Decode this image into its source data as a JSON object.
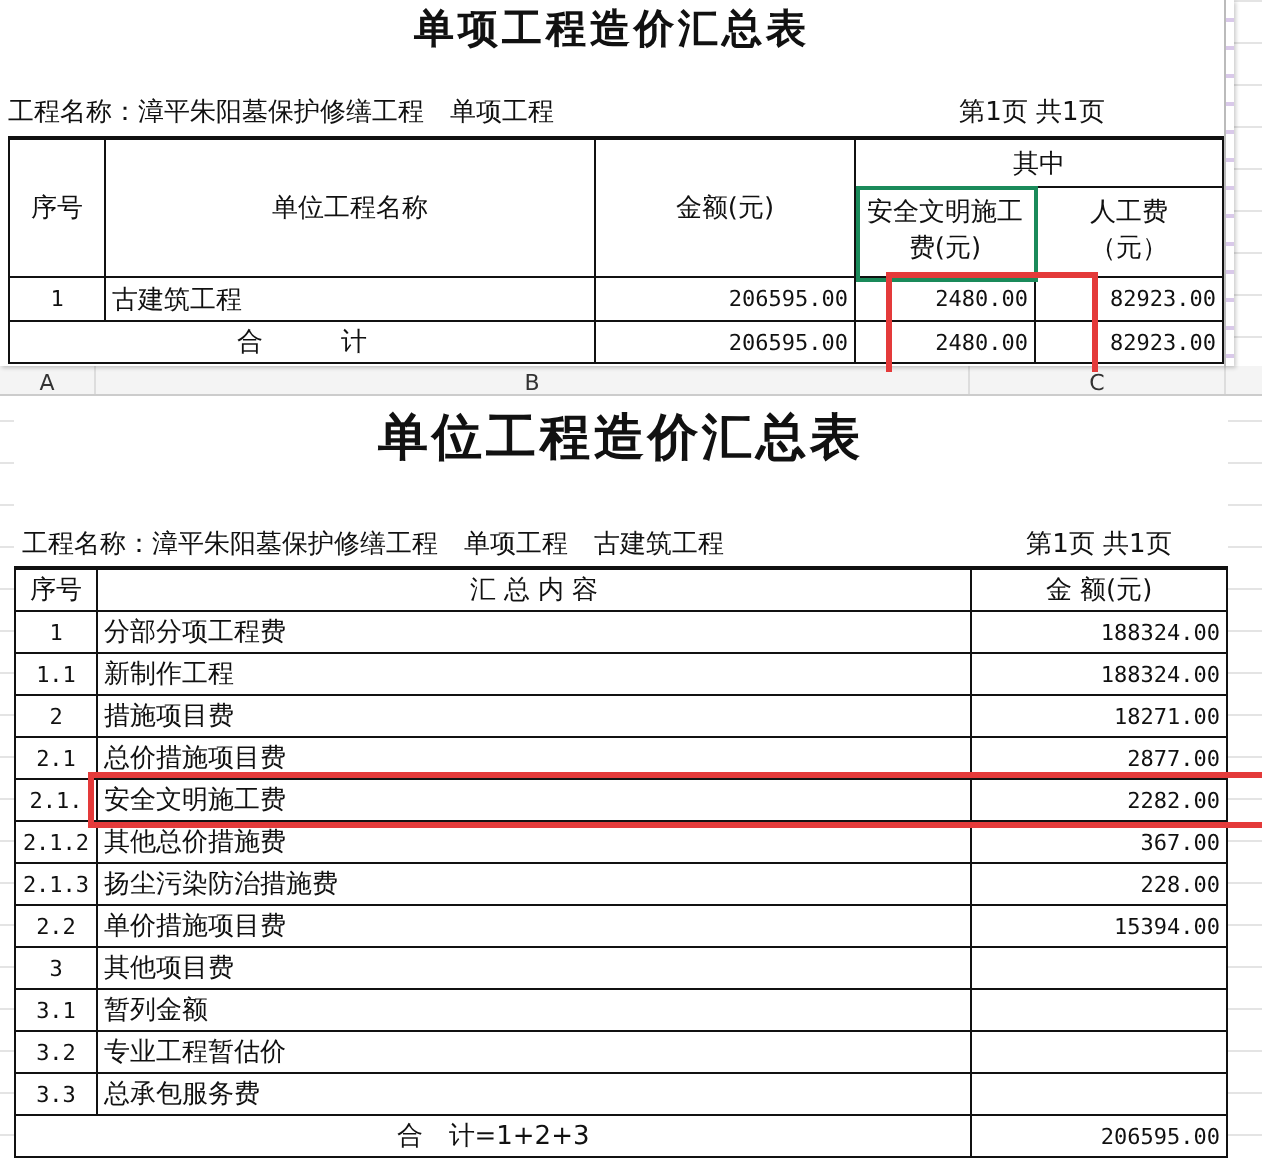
{
  "top_sheet": {
    "title": "单项工程造价汇总表",
    "project": "工程名称：漳平朱阳墓保护修缮工程　单项工程",
    "page": "第1页 共1页",
    "headers": {
      "no": "序号",
      "name": "单位工程名称",
      "amount": "金额(元)",
      "group": "其中",
      "safety": "安全文明施工费(元)",
      "labor": "人工费（元）"
    },
    "rows": [
      {
        "no": "1",
        "name": "古建筑工程",
        "amount": "206595.00",
        "safety": "2480.00",
        "labor": "82923.00"
      }
    ],
    "total": {
      "label": "合　　　计",
      "amount": "206595.00",
      "safety": "2480.00",
      "labor": "82923.00"
    }
  },
  "column_headers": [
    "A",
    "B",
    "C"
  ],
  "bottom_sheet": {
    "title": "单位工程造价汇总表",
    "project": "工程名称：漳平朱阳墓保护修缮工程　单项工程　古建筑工程",
    "page": "第1页 共1页",
    "headers": {
      "no": "序号",
      "content": "汇 总 内 容",
      "amount": "金 额(元)"
    },
    "rows": [
      {
        "no": "1",
        "name": "分部分项工程费",
        "amount": "188324.00"
      },
      {
        "no": "1.1",
        "name": "新制作工程",
        "amount": "188324.00"
      },
      {
        "no": "2",
        "name": "措施项目费",
        "amount": "18271.00"
      },
      {
        "no": "2.1",
        "name": "总价措施项目费",
        "amount": "2877.00"
      },
      {
        "no": "2.1.",
        "name": "安全文明施工费",
        "amount": "2282.00"
      },
      {
        "no": "2.1.2",
        "name": "其他总价措施费",
        "amount": "367.00"
      },
      {
        "no": "2.1.3",
        "name": "扬尘污染防治措施费",
        "amount": "228.00"
      },
      {
        "no": "2.2",
        "name": "单价措施项目费",
        "amount": "15394.00"
      },
      {
        "no": "3",
        "name": "其他项目费"
      },
      {
        "no": "3.1",
        "name": "暂列金额"
      },
      {
        "no": "3.2",
        "name": "专业工程暂估价"
      },
      {
        "no": "3.3",
        "name": "总承包服务费"
      }
    ],
    "total": {
      "label": "合　计=1+2+3",
      "amount": "206595.00"
    }
  }
}
